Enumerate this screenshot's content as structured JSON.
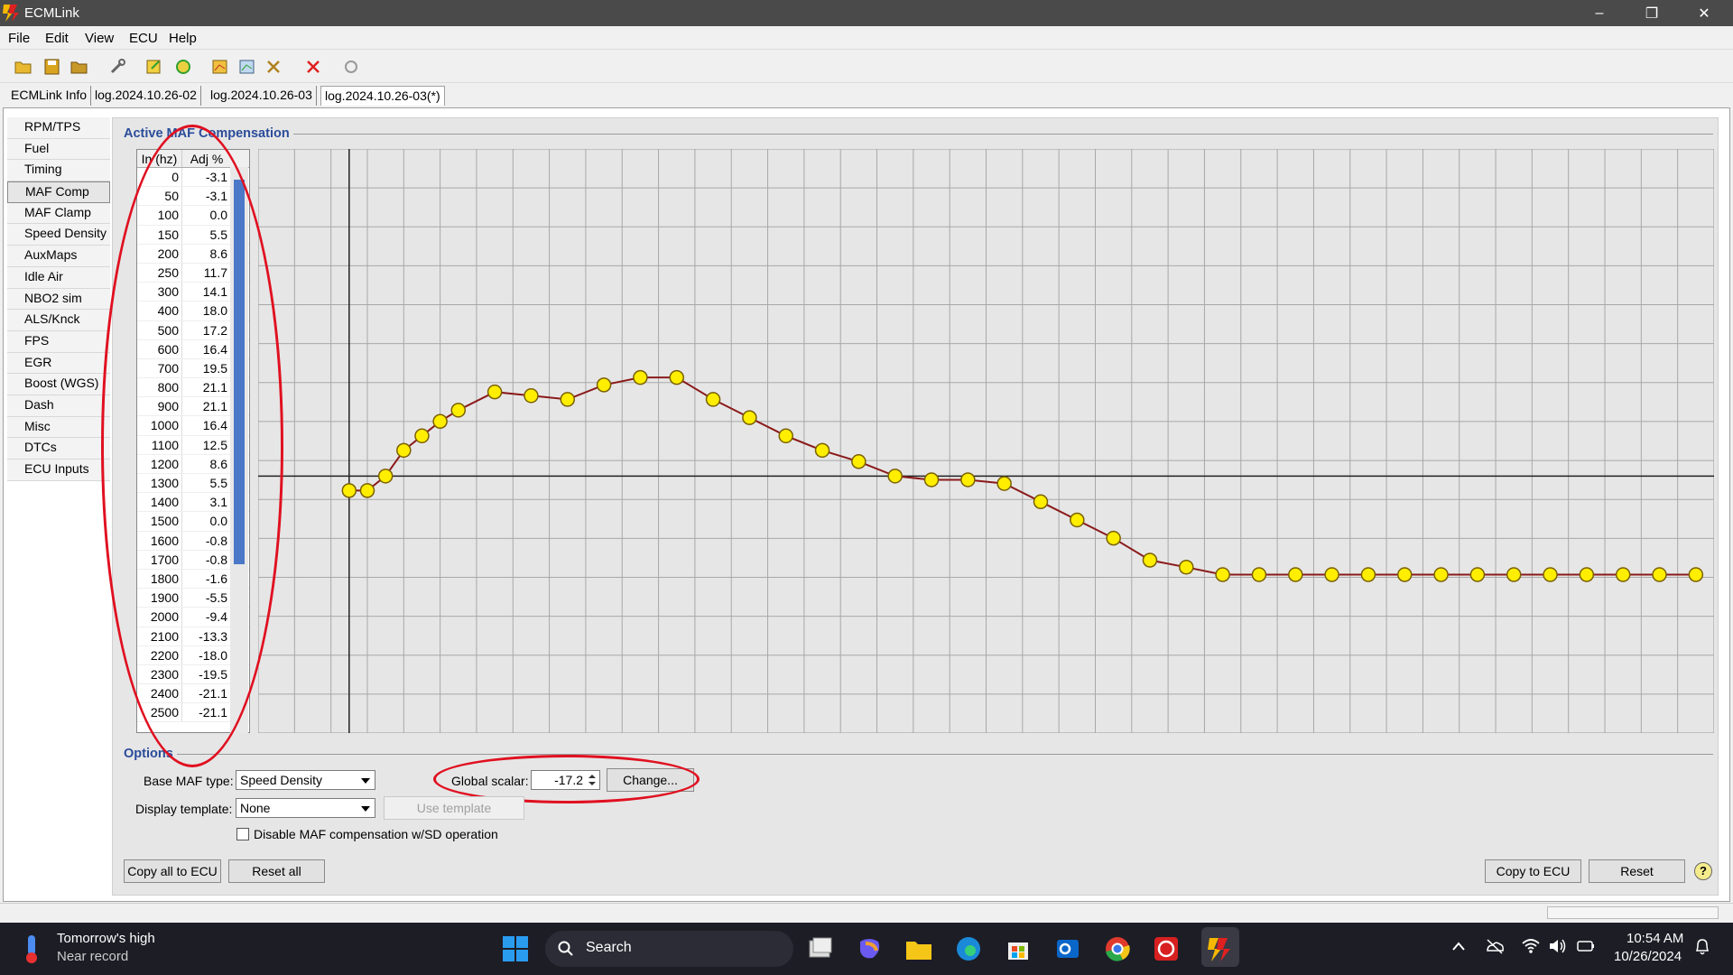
{
  "window": {
    "title": "ECMLink",
    "minimize": "–",
    "restore": "❐",
    "close": "✕"
  },
  "menu": [
    "File",
    "Edit",
    "View",
    "ECU",
    "Help"
  ],
  "toolbar_icons": [
    "open-folder-icon",
    "save-icon",
    "folder-icon",
    "wrench-icon",
    "export-icon",
    "refresh-icon",
    "map-icon",
    "map2-icon",
    "tools-icon",
    "delete-icon",
    "sync-icon"
  ],
  "tabs": [
    "ECMLink Info",
    "log.2024.10.26-02",
    "log.2024.10.26-03",
    "log.2024.10.26-03(*)"
  ],
  "sidebar": [
    "RPM/TPS",
    "Fuel",
    "Timing",
    "MAF Comp",
    "MAF Clamp",
    "Speed Density",
    "AuxMaps",
    "Idle Air",
    "NBO2 sim",
    "ALS/Knck",
    "FPS",
    "EGR",
    "Boost (WGS)",
    "Dash",
    "Misc",
    "DTCs",
    "ECU Inputs"
  ],
  "sidebar_selected": "MAF Comp",
  "group_active": "Active MAF Compensation",
  "group_options": "Options",
  "table": {
    "headers": [
      "In (hz)",
      "Adj %"
    ],
    "rows": [
      [
        "0",
        "-3.1"
      ],
      [
        "50",
        "-3.1"
      ],
      [
        "100",
        "0.0"
      ],
      [
        "150",
        "5.5"
      ],
      [
        "200",
        "8.6"
      ],
      [
        "250",
        "11.7"
      ],
      [
        "300",
        "14.1"
      ],
      [
        "400",
        "18.0"
      ],
      [
        "500",
        "17.2"
      ],
      [
        "600",
        "16.4"
      ],
      [
        "700",
        "19.5"
      ],
      [
        "800",
        "21.1"
      ],
      [
        "900",
        "21.1"
      ],
      [
        "1000",
        "16.4"
      ],
      [
        "1100",
        "12.5"
      ],
      [
        "1200",
        "8.6"
      ],
      [
        "1300",
        "5.5"
      ],
      [
        "1400",
        "3.1"
      ],
      [
        "1500",
        "0.0"
      ],
      [
        "1600",
        "-0.8"
      ],
      [
        "1700",
        "-0.8"
      ],
      [
        "1800",
        "-1.6"
      ],
      [
        "1900",
        "-5.5"
      ],
      [
        "2000",
        "-9.4"
      ],
      [
        "2100",
        "-13.3"
      ],
      [
        "2200",
        "-18.0"
      ],
      [
        "2300",
        "-19.5"
      ],
      [
        "2400",
        "-21.1"
      ],
      [
        "2500",
        "-21.1"
      ]
    ]
  },
  "chart_data": {
    "type": "line",
    "x": [
      0,
      50,
      100,
      150,
      200,
      250,
      300,
      400,
      500,
      600,
      700,
      800,
      900,
      1000,
      1100,
      1200,
      1300,
      1400,
      1500,
      1600,
      1700,
      1800,
      1900,
      2000,
      2100,
      2200,
      2300,
      2400,
      2500,
      2600,
      2700,
      2800,
      2900,
      3000,
      3100,
      3200,
      3300,
      3400,
      3500,
      3600,
      3700
    ],
    "series": [
      {
        "values": [
          -3.1,
          -3.1,
          0.0,
          5.5,
          8.6,
          11.7,
          14.1,
          18.0,
          17.2,
          16.4,
          19.5,
          21.1,
          21.1,
          16.4,
          12.5,
          8.6,
          5.5,
          3.1,
          0.0,
          -0.8,
          -0.8,
          -1.6,
          -5.5,
          -9.4,
          -13.3,
          -18.0,
          -19.5,
          -21.1,
          -21.1,
          -21.1,
          -21.1,
          -21.1,
          -21.1,
          -21.1,
          -21.1,
          -21.1,
          -21.1,
          -21.1,
          -21.1,
          -21.1,
          -21.1
        ]
      }
    ],
    "ylim": [
      -55,
      70
    ],
    "grid": true,
    "line_color": "#8b1a1a",
    "marker_color": "#ffee00"
  },
  "options": {
    "base_maf_label": "Base MAF type:",
    "base_maf_value": "Speed Density",
    "global_scalar_label": "Global scalar:",
    "global_scalar_value": "-17.2",
    "change_button": "Change...",
    "display_template_label": "Display template:",
    "display_template_value": "None",
    "use_template_button": "Use template",
    "disable_checkbox_label": "Disable MAF compensation w/SD operation"
  },
  "buttons": {
    "copy_all": "Copy all to ECU",
    "reset_all": "Reset all",
    "copy_to_ecu": "Copy to ECU",
    "reset": "Reset",
    "help": "?"
  },
  "taskbar": {
    "weather_line1": "Tomorrow's high",
    "weather_line2": "Near record",
    "search_placeholder": "Search",
    "time": "10:54 AM",
    "date": "10/26/2024"
  }
}
